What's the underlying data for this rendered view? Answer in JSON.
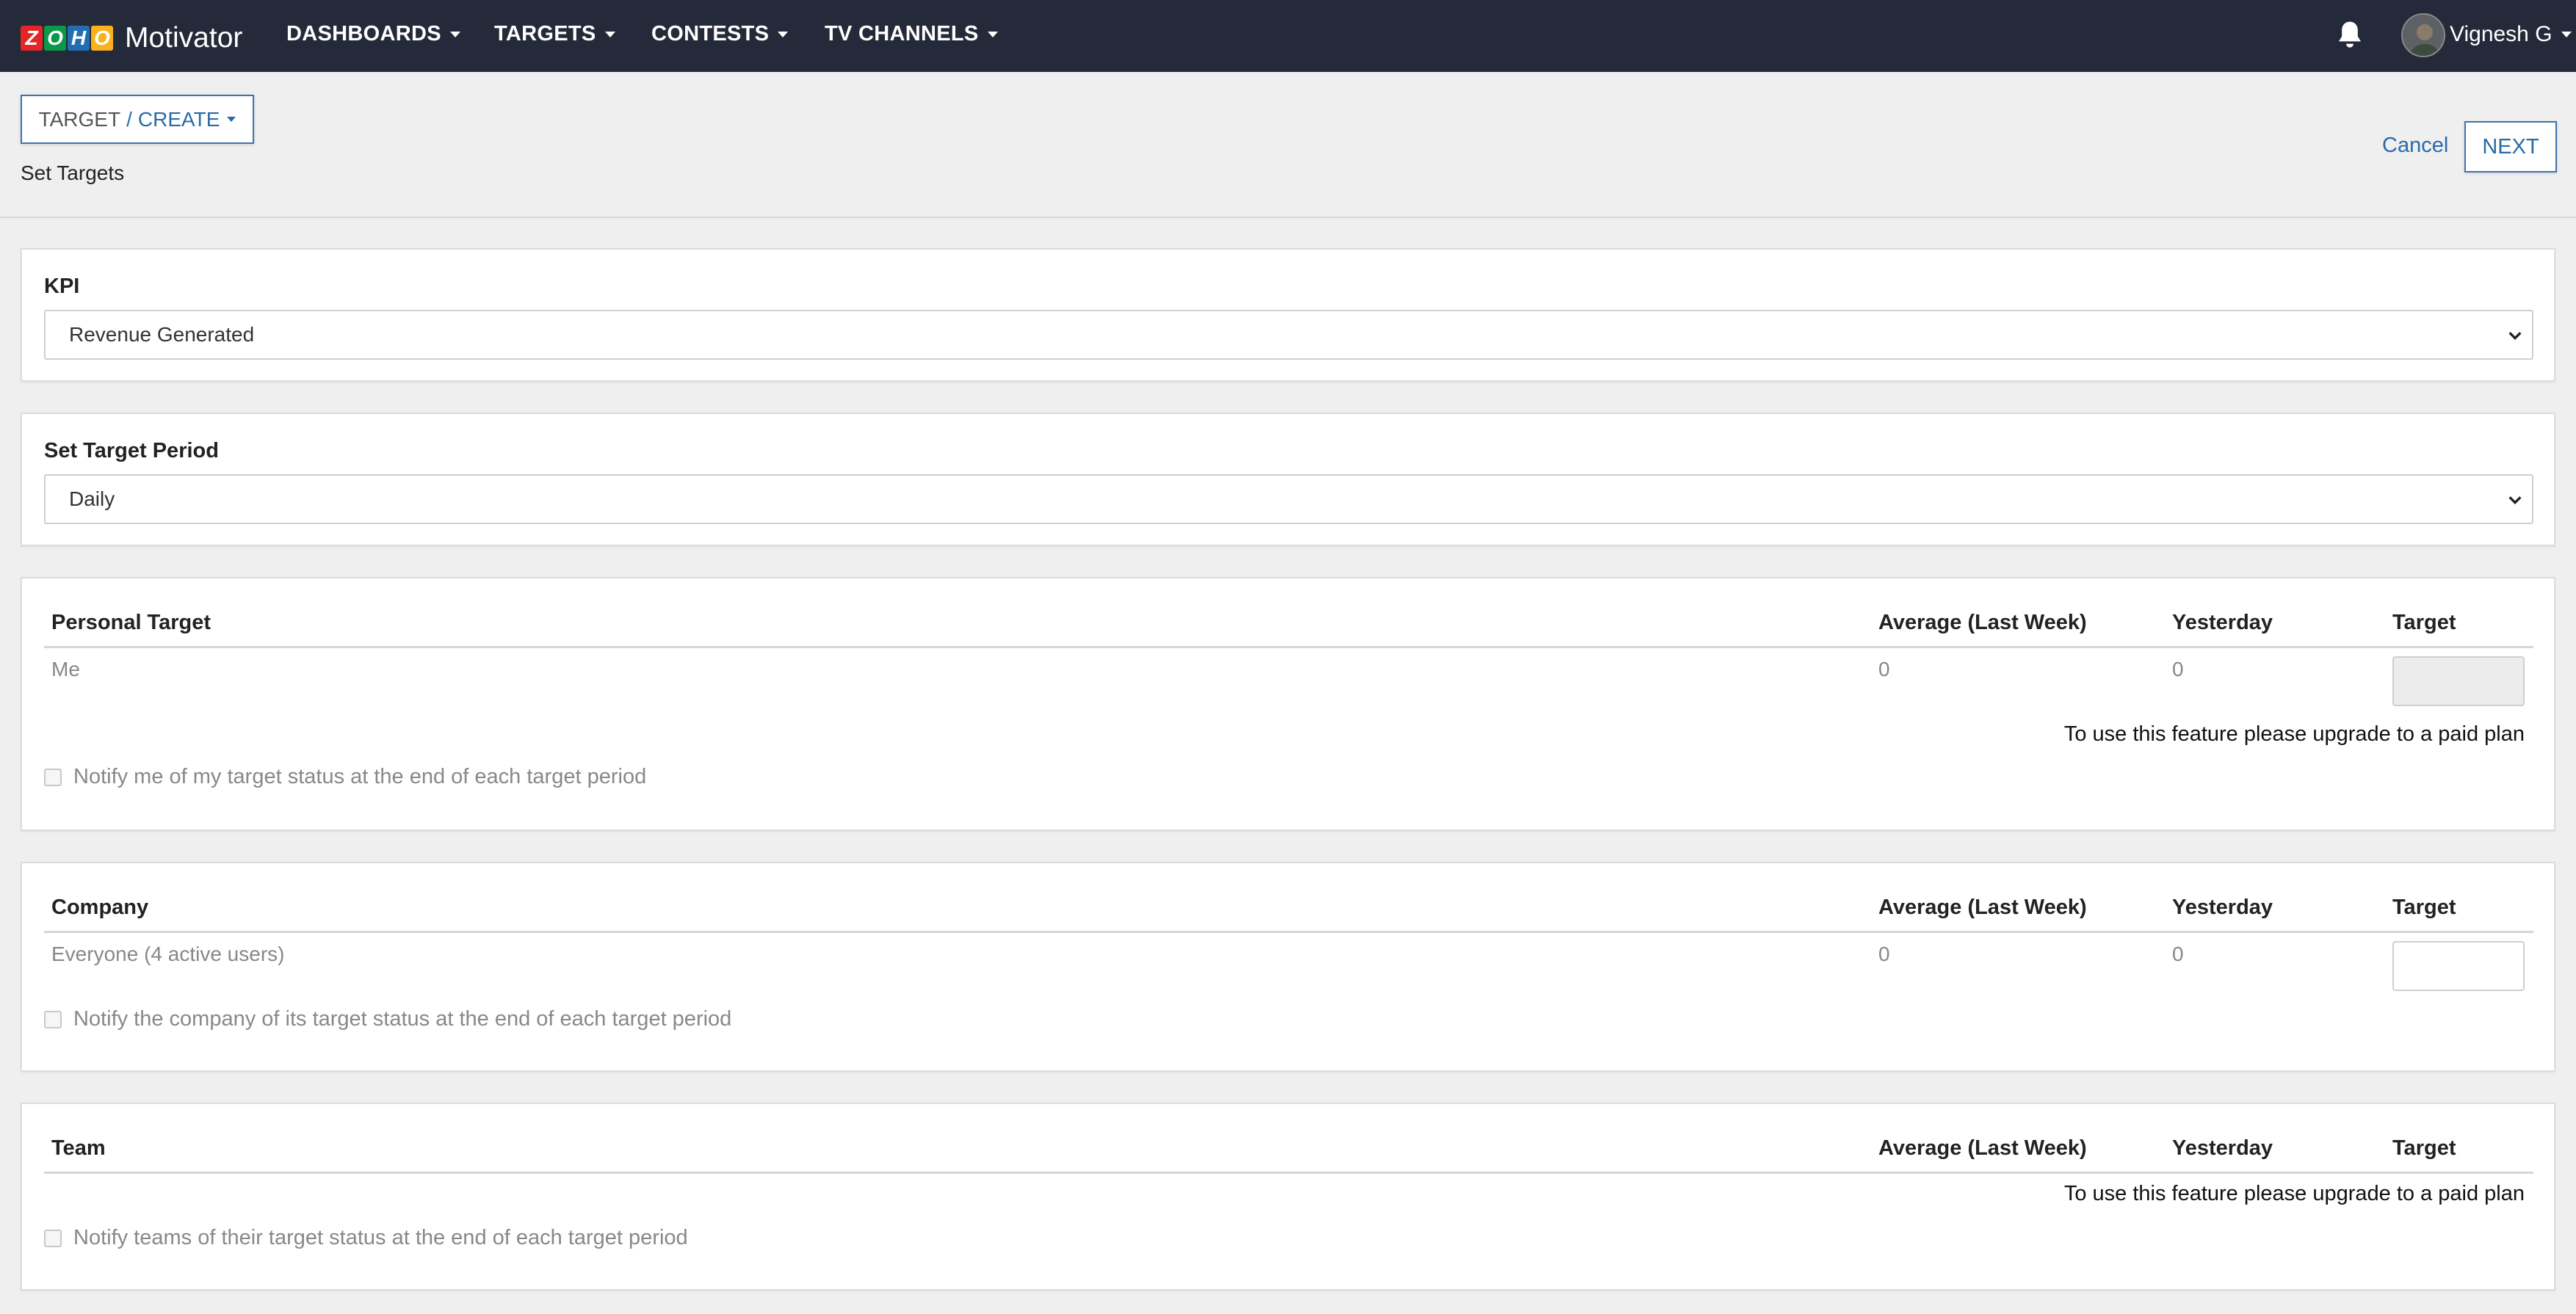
{
  "nav": {
    "logo_letters": [
      "Z",
      "O",
      "H",
      "O"
    ],
    "logo_colors": [
      "#e42527",
      "#089949",
      "#226db4",
      "#f9b21d"
    ],
    "app_name": "Motivator",
    "items": [
      {
        "label": "DASHBOARDS"
      },
      {
        "label": "TARGETS"
      },
      {
        "label": "CONTESTS"
      },
      {
        "label": "TV CHANNELS"
      }
    ],
    "user_name": "Vignesh G"
  },
  "header": {
    "breadcrumb_root": "TARGET",
    "breadcrumb_separator": "/",
    "breadcrumb_current": "CREATE",
    "subtitle": "Set Targets",
    "cancel_label": "Cancel",
    "next_label": "NEXT"
  },
  "kpi": {
    "label": "KPI",
    "selected": "Revenue Generated"
  },
  "period": {
    "label": "Set Target Period",
    "selected": "Daily"
  },
  "columns": {
    "avg": "Average (Last Week)",
    "yesterday": "Yesterday",
    "target": "Target"
  },
  "personal": {
    "title": "Personal Target",
    "row_name": "Me",
    "avg_value": "0",
    "yesterday_value": "0",
    "upgrade_note": "To use this feature please upgrade to a paid plan",
    "notify_label": "Notify me of my target status at the end of each target period"
  },
  "company": {
    "title": "Company",
    "row_name": "Everyone (4 active users)",
    "avg_value": "0",
    "yesterday_value": "0",
    "notify_label": "Notify the company of its target status at the end of each target period"
  },
  "team": {
    "title": "Team",
    "upgrade_note": "To use this feature please upgrade to a paid plan",
    "notify_label": "Notify teams of their target status at the end of each target period"
  },
  "colors": {
    "navbar": "#252a3a",
    "accent": "#2a6aa8",
    "page_bg": "#efefef"
  }
}
